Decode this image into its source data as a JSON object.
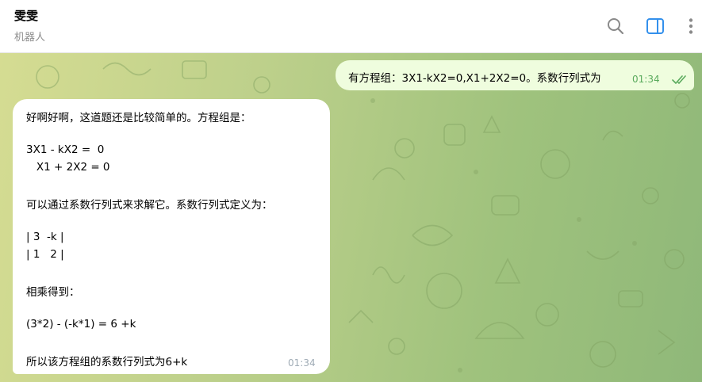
{
  "header": {
    "title": "雯雯",
    "subtitle": "机器人",
    "icons": [
      "search-icon",
      "sidebar-toggle-icon",
      "more-vertical-icon"
    ],
    "accent_color": "#3390ec"
  },
  "messages": {
    "outgoing": {
      "text": "有方程组：3X1-kX2=0,X1+2X2=0。系数行列式为",
      "time": "01:34",
      "status_icon": "double-check-icon"
    },
    "incoming": {
      "lines": [
        "好啊好啊，这道题还是比较简单的。方程组是：",
        "",
        "3X1 - kX2 =  0",
        "   X1 + 2X2 = 0",
        "",
        "可以通过系数行列式来求解它。系数行列式定义为：",
        "",
        "| 3  -k |",
        "| 1   2 |",
        "",
        "相乘得到：",
        "",
        "(3*2) - (-k*1) = 6 +k",
        "",
        "所以该方程组的系数行列式为6+k"
      ],
      "time": "01:34"
    }
  }
}
